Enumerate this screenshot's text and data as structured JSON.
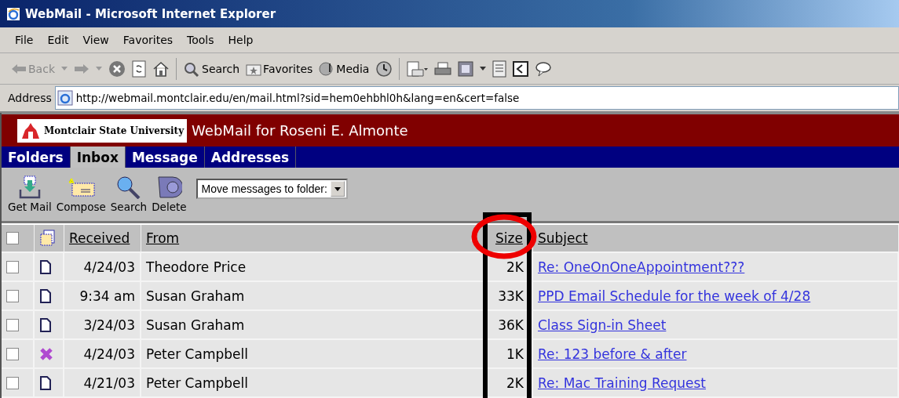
{
  "window": {
    "title": "WebMail - Microsoft Internet Explorer"
  },
  "menu": [
    "File",
    "Edit",
    "View",
    "Favorites",
    "Tools",
    "Help"
  ],
  "browser_toolbar": {
    "back": "Back",
    "search": "Search",
    "favorites": "Favorites",
    "media": "Media"
  },
  "address_bar": {
    "label": "Address",
    "value": "http://webmail.montclair.edu/en/mail.html?sid=hem0ehbhl0h&lang=en&cert=false"
  },
  "header": {
    "logo_text": "Montclair State University",
    "title": "WebMail for Roseni E. Almonte"
  },
  "tabs": [
    {
      "label": "Folders",
      "selected": false
    },
    {
      "label": "Inbox",
      "selected": true
    },
    {
      "label": "Message",
      "selected": false
    },
    {
      "label": "Addresses",
      "selected": false
    }
  ],
  "mail_toolbar": {
    "buttons": [
      "Get Mail",
      "Compose",
      "Search",
      "Delete"
    ],
    "move_select": "Move messages to folder:"
  },
  "table": {
    "select_all_checked": false,
    "columns": {
      "received": "Received",
      "from": "From",
      "size": "Size",
      "subject": "Subject"
    },
    "rows": [
      {
        "kind": "message",
        "checked": false,
        "received": "4/24/03",
        "from": "Theodore Price",
        "size": "2K",
        "subject": "Re: OneOnOneAppointment???"
      },
      {
        "kind": "message",
        "checked": false,
        "received": "9:34 am",
        "from": "Susan Graham",
        "size": "33K",
        "subject": "PPD Email Schedule for the week of 4/28"
      },
      {
        "kind": "message",
        "checked": false,
        "received": "3/24/03",
        "from": "Susan Graham",
        "size": "36K",
        "subject": "Class Sign-in Sheet"
      },
      {
        "kind": "deleted",
        "checked": false,
        "received": "4/24/03",
        "from": "Peter Campbell",
        "size": "1K",
        "subject": "Re: 123 before & after"
      },
      {
        "kind": "message",
        "checked": false,
        "received": "4/21/03",
        "from": "Peter Campbell",
        "size": "2K",
        "subject": "Re: Mac Training Request"
      }
    ]
  }
}
